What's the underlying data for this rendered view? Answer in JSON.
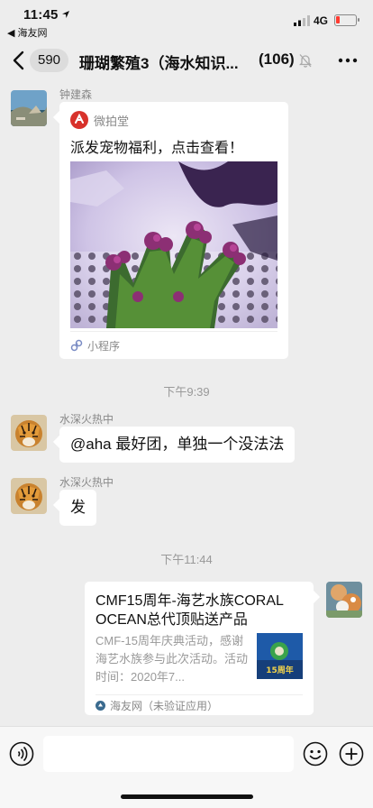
{
  "status_bar": {
    "time": "11:45",
    "back_app": "◀ 海友网",
    "network": "4G"
  },
  "nav": {
    "unread_count": "590",
    "title": "珊瑚繁殖3（海水知识...",
    "member_count": "(106)"
  },
  "messages": [
    {
      "sender": "钟建森",
      "type": "mini_program",
      "source": "微拍堂",
      "title": "派发宠物福利，点击查看！",
      "footer": "小程序"
    },
    {
      "type": "time",
      "text": "下午9:39"
    },
    {
      "sender": "水深火热中",
      "type": "text",
      "text": "@aha 最好团，单独一个没法法"
    },
    {
      "sender": "水深火热中",
      "type": "text",
      "text": "发"
    },
    {
      "type": "time",
      "text": "下午11:44"
    },
    {
      "sender": "",
      "type": "link",
      "title": "CMF15周年-海艺水族CORAL OCEAN总代顶贴送产品",
      "description": "CMF-15周年庆典活动，感谢海艺水族参与此次活动。活动时间：2020年7...",
      "thumb_text": "15周年",
      "footer": "海友网（未验证应用）"
    }
  ],
  "colors": {
    "background": "#ededed",
    "bubble": "#ffffff",
    "accent_red": "#d8322b",
    "battery_low": "#ff3b30"
  },
  "icons": {
    "voice": "voice-icon",
    "emoji": "emoji-icon",
    "plus": "plus-icon",
    "more": "more-icon",
    "mute": "mute-bell-icon"
  }
}
